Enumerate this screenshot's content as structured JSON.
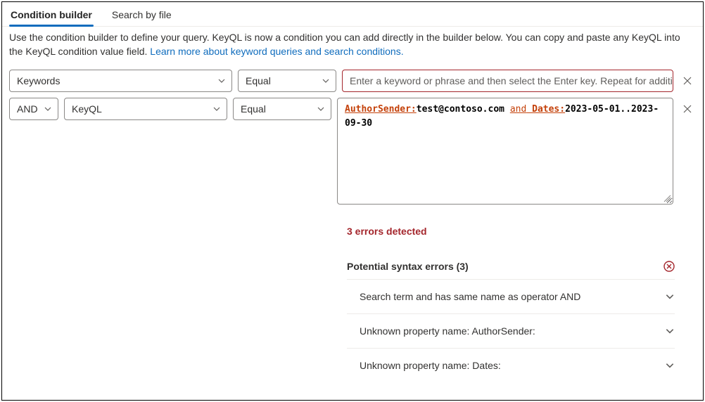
{
  "tabs": {
    "builder": "Condition builder",
    "file": "Search by file"
  },
  "description": {
    "text": "Use the condition builder to define your query. KeyQL is now a condition you can add directly in the builder below. You can copy and paste any KeyQL into the KeyQL condition value field. ",
    "link": "Learn more about keyword queries and search conditions."
  },
  "row1": {
    "field": "Keywords",
    "operator": "Equal",
    "placeholder": "Enter a keyword or phrase and then select the Enter key. Repeat for additional..."
  },
  "row2": {
    "logic": "AND",
    "field": "KeyQL",
    "operator": "Equal",
    "keyql": {
      "p1": "AuthorSender:",
      "v1": "test@contoso.com ",
      "op": "and",
      "p2": " Dates:",
      "v2": "2023-05-01..2023-09-30"
    }
  },
  "errors": {
    "heading": "3 errors detected",
    "subheading": "Potential syntax errors (3)",
    "items": [
      "Search term and has same name as operator AND",
      "Unknown property name: AuthorSender:",
      "Unknown property name: Dates:"
    ]
  }
}
